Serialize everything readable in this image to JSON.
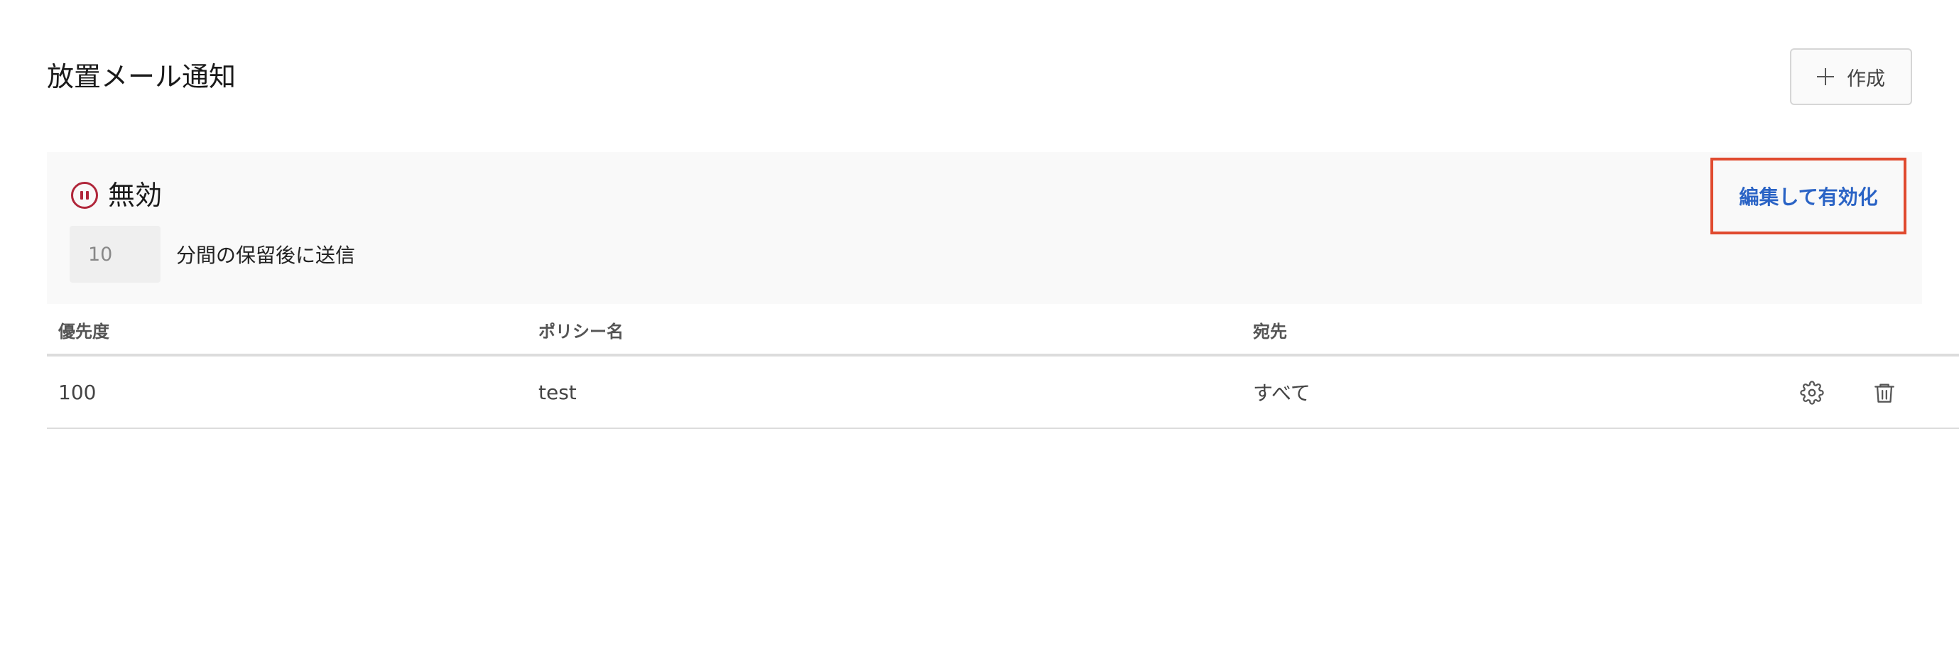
{
  "header": {
    "title": "放置メール通知",
    "create_label": "作成"
  },
  "status": {
    "label": "無効",
    "delay_value": "10",
    "delay_suffix": "分間の保留後に送信",
    "edit_enable_label": "編集して有効化",
    "status_color": "#b0263a",
    "link_color": "#2a63c5",
    "highlight_color": "#e04a2f"
  },
  "table": {
    "columns": [
      "優先度",
      "ポリシー名",
      "宛先"
    ],
    "rows": [
      {
        "priority": "100",
        "name": "test",
        "destination": "すべて"
      }
    ]
  },
  "icons": {
    "create": "plus-icon",
    "status": "pause-icon",
    "settings": "gear-icon",
    "delete": "trash-icon"
  }
}
